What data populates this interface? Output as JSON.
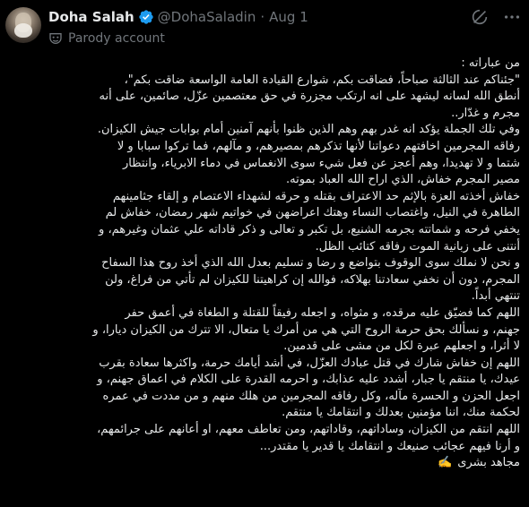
{
  "author": {
    "display_name": "Doha Salah",
    "handle": "@DohaSaladin",
    "separator": "·",
    "date": "Aug 1",
    "parody_label": "Parody account"
  },
  "icons": {
    "verified": "verified-badge-icon",
    "parody": "mask-icon",
    "grok": "grok-icon",
    "more": "more-icon"
  },
  "colors": {
    "verified": "#1d9bf0",
    "secondary_text": "#71767b",
    "background": "#000000"
  },
  "tweet": {
    "lines": [
      "من عباراته :",
      "\"جئناكم عند الثالثة صباحاً، فضاقت بكم، شوارع القيادة العامة الواسعة ضاقت بكم\"،",
      "أنطق الله لسانه ليشهد على انه ارتكب مجزرة في حق معتصمين عزّل، صائمين، على أنه",
      "مجرم و غدّار..",
      "وفي تلك الجملة يؤكد انه غدر بهم وهم الذين ظنوا بأنهم آمنين أمام بوابات جيش الكيزان.",
      "رفاقه المجرمين اخافتهم دعواتنا لأنها تذكرهم بمصيرهم، و مآلهم، فما تركوا سبابا و لا",
      "شتما و لا تهديدا، وهم أعجز عن فعل شيء سوى الانغماس في دماء الابرياء، وانتظار",
      "مصير المجرم خفاش، الذي اراح الله العباد بموته.",
      "خفاش أخذته العزة بالإثم حد الاعتراف بقتله و حرقه لشهداء الاعتصام و إلقاء جثامينهم",
      "الطاهرة في النيل، واغتصاب النساء وهتك اعراضهن في خواتيم شهر رمضان، خفاش لم",
      "يخفي فرحه و شماتته بجرمه الشنيع، بل تكبر و تعالى و ذكر قاداته علي عثمان وغيرهم، و",
      "أنتنى على زبانية الموت رفاقه كتائب الظل.",
      "و نحن لا نملك سوى الوقوف بتواضع و رضا و تسليم بعدل الله الذي أخذ روح هذا السفاح",
      "المجرم، دون أن نخفي سعادتنا بهلاكه، فوالله إن كراهيتنا للكيزان لم تأتي من فراغ، ولن",
      "تنتهي أبداً.",
      "اللهم كما فضيّق عليه مرقده، و مثواه، و اجعله رفيقاً للقتلة و الطغاة في أعمق حفر",
      "جهنم، و نسألك بحق حرمة الروح التي هي من أمرك يا متعال، الا تترك من الكيزان ديارا، و",
      "لا أثرا، و اجعلهم عبرة لكل من مشى على قدمين.",
      "اللهم إن خفاش شارك في قتل عبادك العزّل، في أشد أيامك حرمة، واكثرها سعادة بقرب",
      "عيدك، يا منتقم يا جبار، أشدد عليه عذابك، و احرمه القدرة على الكلام في اعماق جهنم، و",
      "اجعل الحزن و الحسرة مآله، وكل رفاقه المجرمين من هلك منهم و من مددت في عمره",
      "لحكمة منك، اننا مؤمنين بعدلك و انتقامك يا منتقم.",
      "اللهم انتقم من الكيزان، وساداتهم، وقاداتهم، ومن تعاطف معهم، او أعانهم على جرائمهم،",
      "و أرنا فيهم عجائب صنيعك و انتقامك يا قدير يا مقتدر..."
    ],
    "signature": "مجاهد  بشرى",
    "signature_emoji": "✍️"
  }
}
